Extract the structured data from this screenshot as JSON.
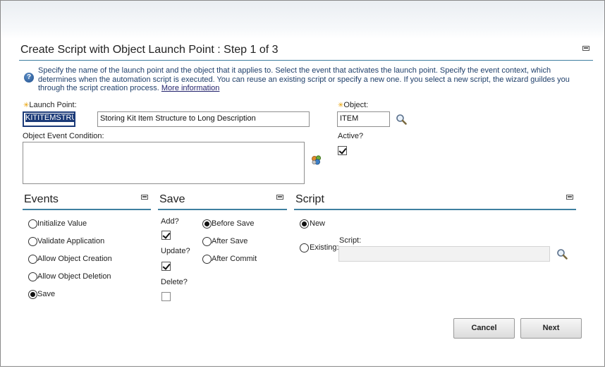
{
  "dialog": {
    "title": "Create Script with Object Launch Point : Step 1 of 3",
    "help_text": "Specify the name of the launch point and the object that it applies to. Select the event that activates the launch point. Specify the event context, which determines when the automation script is executed. You can reuse an existing script or specify a new one. If you select a new script, the wizard guildes you through the script creation process.",
    "more_info_link": "More information"
  },
  "launch_point": {
    "label": "Launch Point:",
    "required_marker": "✳",
    "value": "KITITEMSTRU",
    "description": "Storing Kit Item Structure to Long Description"
  },
  "object": {
    "label": "Object:",
    "required_marker": "✳",
    "value": "ITEM"
  },
  "condition": {
    "label": "Object Event Condition:",
    "value": ""
  },
  "active": {
    "label": "Active?",
    "checked": true
  },
  "events": {
    "title": "Events",
    "options": [
      {
        "label": "Initialize Value",
        "selected": false
      },
      {
        "label": "Validate Application",
        "selected": false
      },
      {
        "label": "Allow Object Creation",
        "selected": false
      },
      {
        "label": "Allow Object Deletion",
        "selected": false
      },
      {
        "label": "Save",
        "selected": true
      }
    ]
  },
  "save": {
    "title": "Save",
    "add_label": "Add?",
    "add_checked": true,
    "update_label": "Update?",
    "update_checked": true,
    "delete_label": "Delete?",
    "delete_checked": false,
    "timing_options": [
      {
        "label": "Before Save",
        "selected": true
      },
      {
        "label": "After Save",
        "selected": false
      },
      {
        "label": "After Commit",
        "selected": false
      }
    ]
  },
  "script": {
    "title": "Script",
    "new_label": "New",
    "new_selected": true,
    "existing_label": "Existing:",
    "existing_selected": false,
    "script_label": "Script:",
    "script_value": ""
  },
  "buttons": {
    "cancel": "Cancel",
    "next": "Next"
  }
}
